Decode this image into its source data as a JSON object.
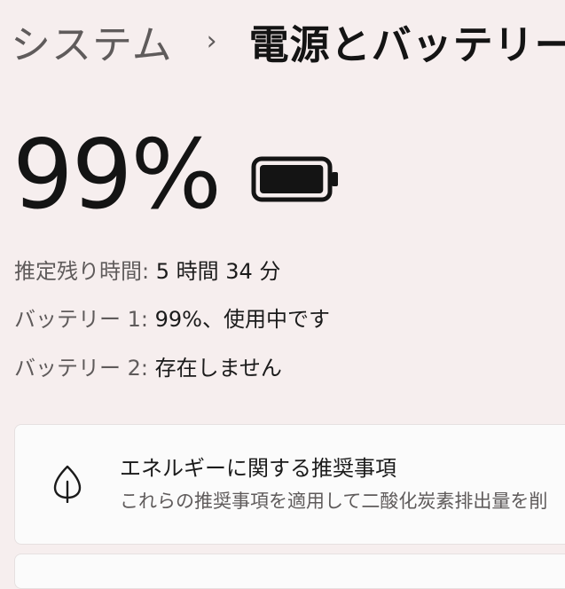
{
  "breadcrumb": {
    "parent": "システム",
    "separator": "›",
    "current": "電源とバッテリー"
  },
  "battery": {
    "percent_text": "99%",
    "level": 0.99,
    "icon": "battery-full-icon"
  },
  "info": {
    "remaining": {
      "label": "推定残り時間:",
      "value": "5 時間 34 分"
    },
    "battery1": {
      "label": "バッテリー 1:",
      "value": "99%、使用中です"
    },
    "battery2": {
      "label": "バッテリー 2:",
      "value": "存在しません"
    }
  },
  "recommendations": {
    "icon": "leaf-icon",
    "title": "エネルギーに関する推奨事項",
    "description": "これらの推奨事項を適用して二酸化炭素排出量を削"
  }
}
